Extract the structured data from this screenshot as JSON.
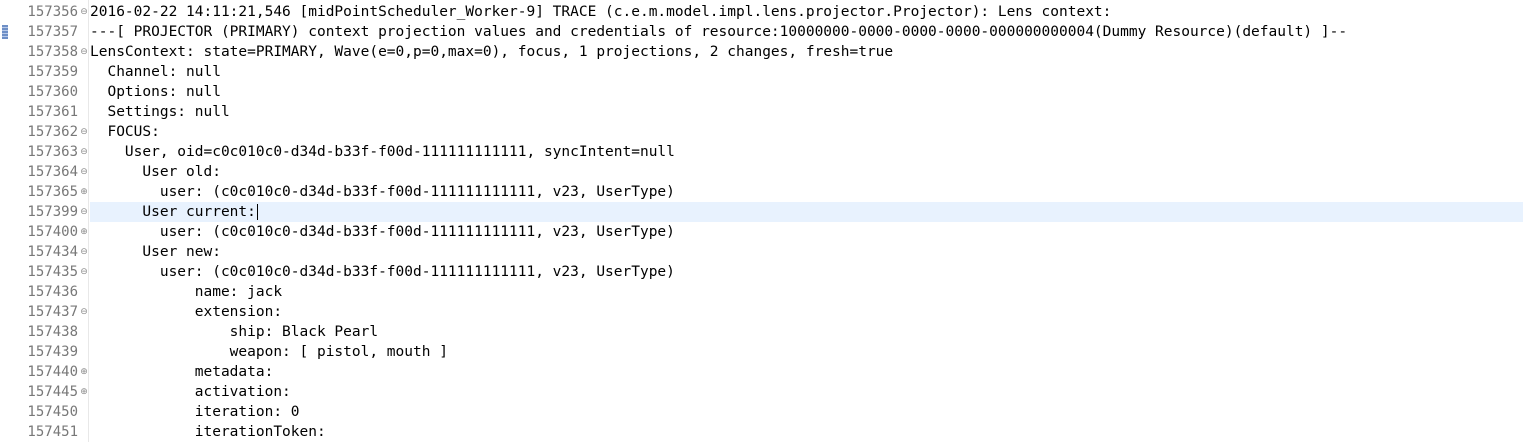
{
  "editor": {
    "lines": [
      {
        "num": "157356",
        "fold": "⊖",
        "text": "2016-02-22 14:11:21,546 [midPointScheduler_Worker-9] TRACE (c.e.m.model.impl.lens.projector.Projector): Lens context:"
      },
      {
        "num": "157357",
        "fold": "",
        "text": "---[ PROJECTOR (PRIMARY) context projection values and credentials of resource:10000000-0000-0000-0000-000000000004(Dummy Resource)(default) ]--"
      },
      {
        "num": "157358",
        "fold": "⊖",
        "text": "LensContext: state=PRIMARY, Wave(e=0,p=0,max=0), focus, 1 projections, 2 changes, fresh=true"
      },
      {
        "num": "157359",
        "fold": "",
        "text": "  Channel: null"
      },
      {
        "num": "157360",
        "fold": "",
        "text": "  Options: null"
      },
      {
        "num": "157361",
        "fold": "",
        "text": "  Settings: null"
      },
      {
        "num": "157362",
        "fold": "⊖",
        "text": "  FOCUS:"
      },
      {
        "num": "157363",
        "fold": "⊖",
        "text": "    User, oid=c0c010c0-d34d-b33f-f00d-111111111111, syncIntent=null"
      },
      {
        "num": "157364",
        "fold": "⊖",
        "text": "      User old:"
      },
      {
        "num": "157365",
        "fold": "⊕",
        "text": "        user: (c0c010c0-d34d-b33f-f00d-111111111111, v23, UserType)"
      },
      {
        "num": "157399",
        "fold": "⊖",
        "text": "      User current:"
      },
      {
        "num": "157400",
        "fold": "⊕",
        "text": "        user: (c0c010c0-d34d-b33f-f00d-111111111111, v23, UserType)"
      },
      {
        "num": "157434",
        "fold": "⊖",
        "text": "      User new:"
      },
      {
        "num": "157435",
        "fold": "⊖",
        "text": "        user: (c0c010c0-d34d-b33f-f00d-111111111111, v23, UserType)"
      },
      {
        "num": "157436",
        "fold": "",
        "text": "            name: jack"
      },
      {
        "num": "157437",
        "fold": "⊖",
        "text": "            extension:"
      },
      {
        "num": "157438",
        "fold": "",
        "text": "                ship: Black Pearl"
      },
      {
        "num": "157439",
        "fold": "",
        "text": "                weapon: [ pistol, mouth ]"
      },
      {
        "num": "157440",
        "fold": "⊕",
        "text": "            metadata:"
      },
      {
        "num": "157445",
        "fold": "⊕",
        "text": "            activation:"
      },
      {
        "num": "157450",
        "fold": "",
        "text": "            iteration: 0"
      },
      {
        "num": "157451",
        "fold": "",
        "text": "            iterationToken:"
      }
    ],
    "highlight_line": "157399",
    "bookmark_line": "157357",
    "colors": {
      "highlight": "#e8f2fe",
      "line_number": "#787878",
      "text": "#000000"
    },
    "icons": {
      "fold_expanded": "minus-circle-icon",
      "fold_collapsed": "plus-circle-icon",
      "bookmark": "bookmark-icon"
    }
  }
}
